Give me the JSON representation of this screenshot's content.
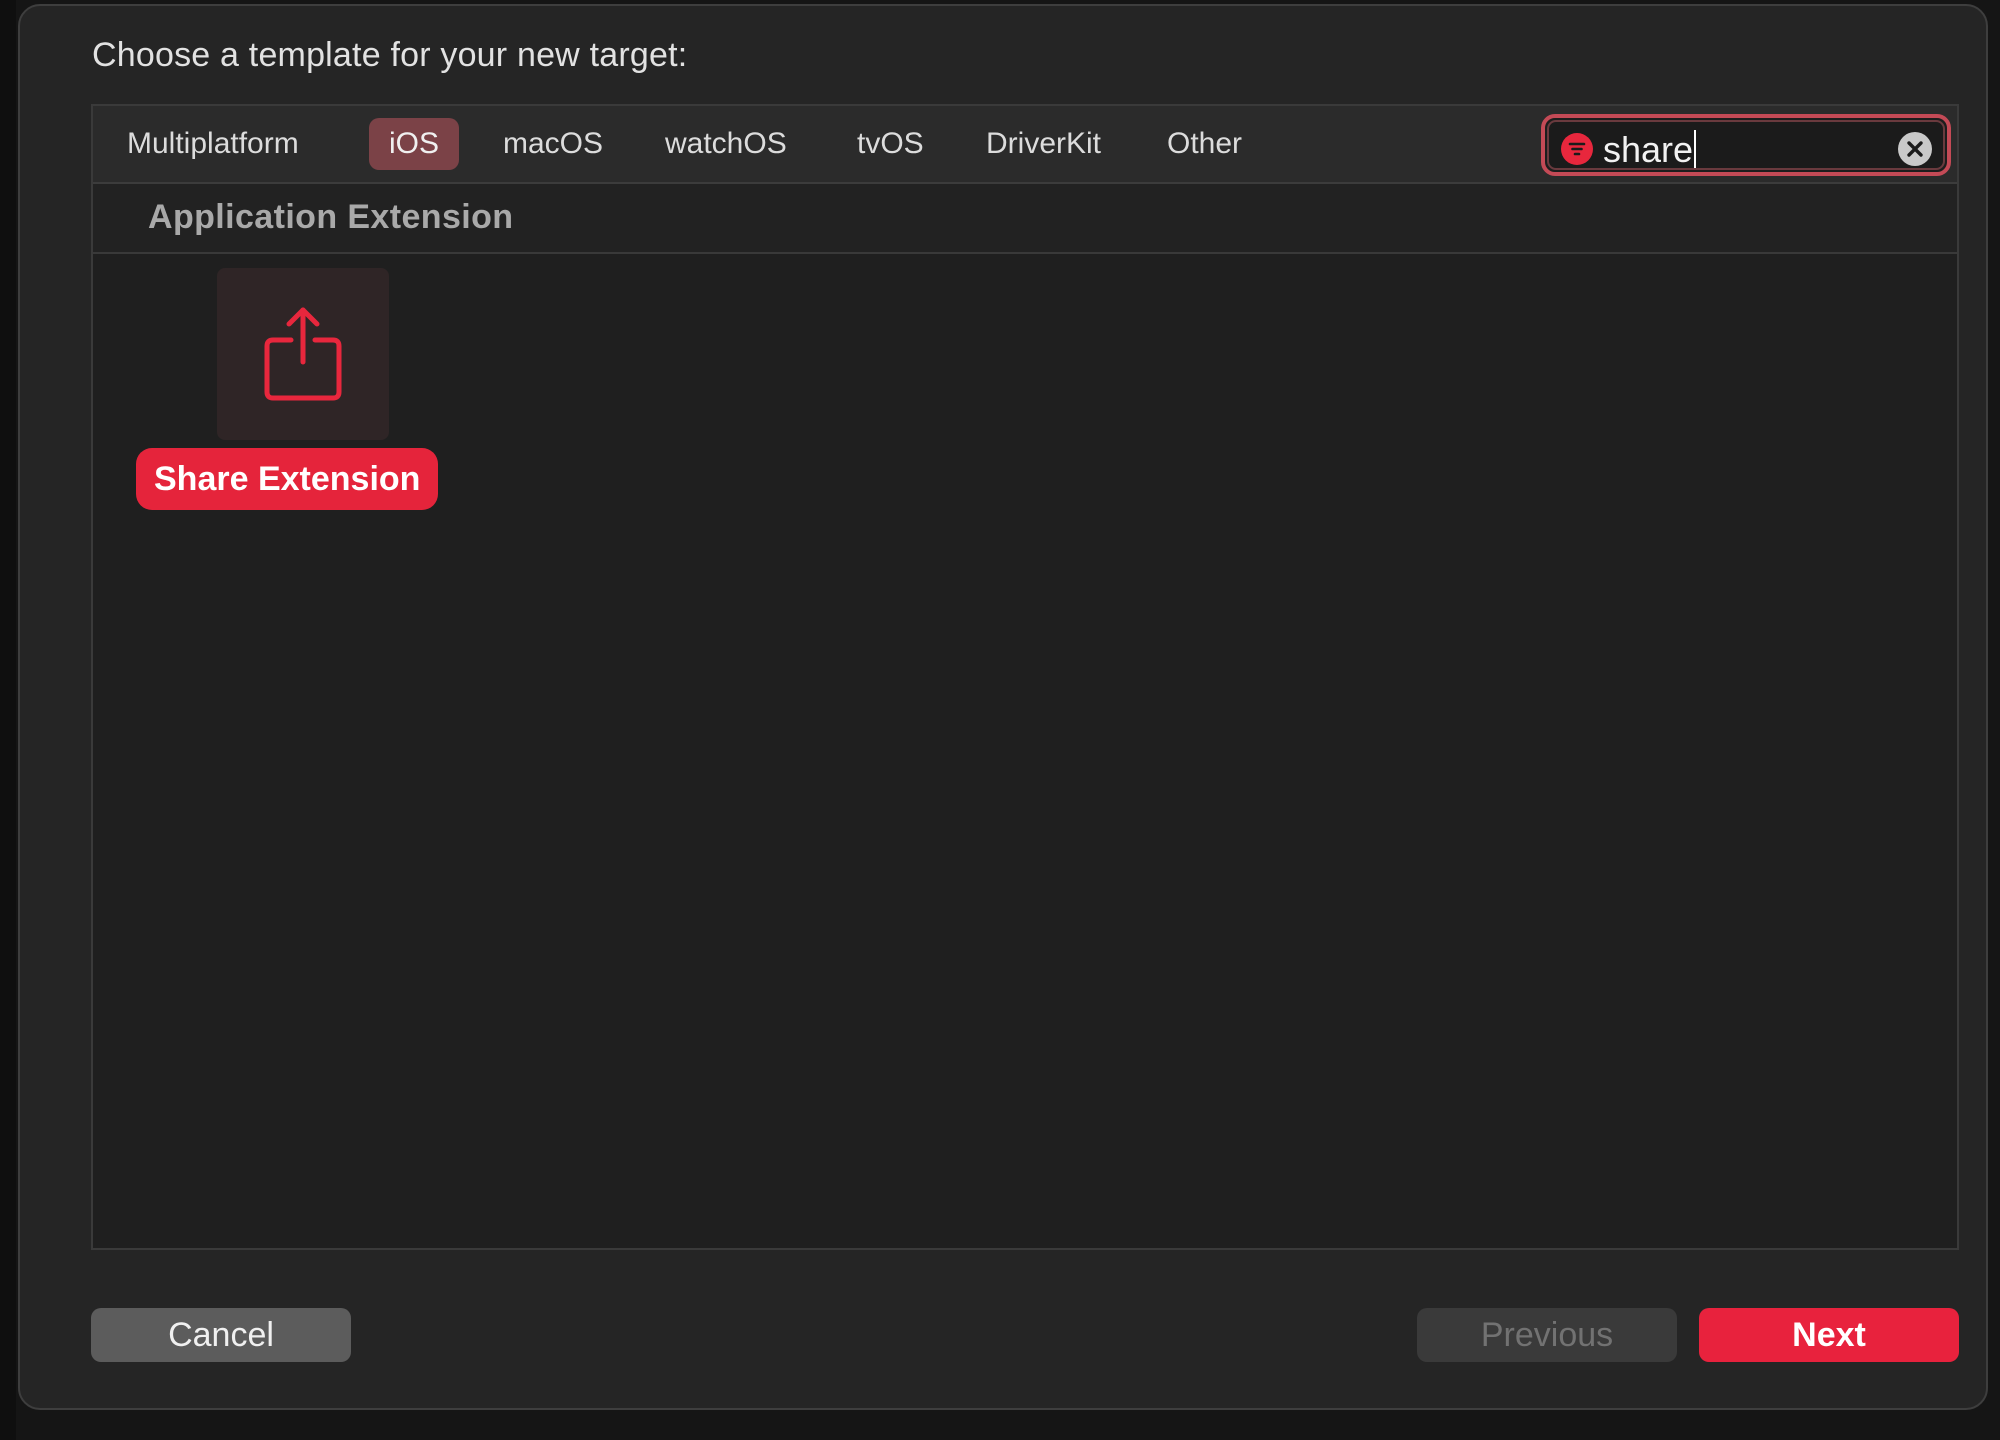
{
  "dialog": {
    "title": "Choose a template for your new target:"
  },
  "tabs": [
    {
      "label": "Multiplatform",
      "selected": false
    },
    {
      "label": "iOS",
      "selected": true
    },
    {
      "label": "macOS",
      "selected": false
    },
    {
      "label": "watchOS",
      "selected": false
    },
    {
      "label": "tvOS",
      "selected": false
    },
    {
      "label": "DriverKit",
      "selected": false
    },
    {
      "label": "Other",
      "selected": false
    }
  ],
  "search": {
    "value": "share",
    "filter_icon": "filter-icon",
    "clear_icon": "clear-icon"
  },
  "section": {
    "title": "Application Extension"
  },
  "templates": [
    {
      "label": "Share Extension",
      "icon": "share-icon",
      "selected": true
    }
  ],
  "buttons": {
    "cancel": "Cancel",
    "previous": "Previous",
    "next": "Next"
  },
  "colors": {
    "accent": "#e8223d",
    "selected_tab": "#7b4247",
    "search_focus_ring": "#c44a56",
    "background": "#252525"
  }
}
